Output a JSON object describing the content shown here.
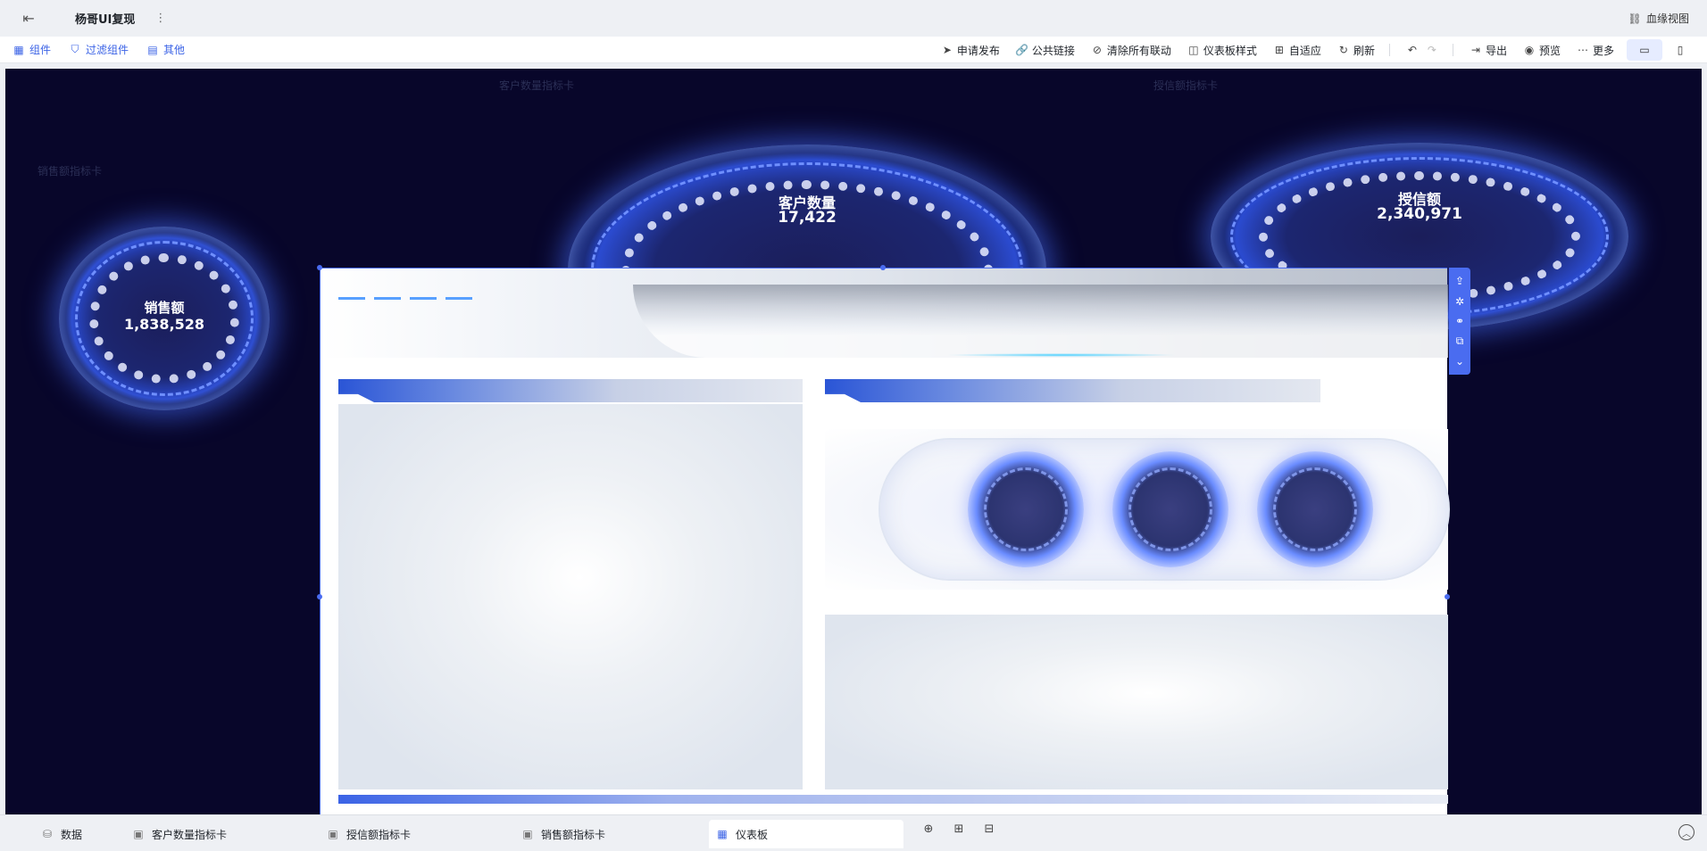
{
  "topbar": {
    "back_icon": "exit-icon",
    "title": "杨哥UI复现",
    "more_icon": "⋮",
    "lineage_label": "血缘视图"
  },
  "toolbar": {
    "left": [
      {
        "label": "组件",
        "icon": "component-icon"
      },
      {
        "label": "过滤组件",
        "icon": "filter-component-icon"
      },
      {
        "label": "其他",
        "icon": "other-icon"
      }
    ],
    "right": [
      {
        "label": "申请发布",
        "icon": "send-icon"
      },
      {
        "label": "公共链接",
        "icon": "link-icon"
      },
      {
        "label": "清除所有联动",
        "icon": "unlink-icon"
      },
      {
        "label": "仪表板样式",
        "icon": "style-icon"
      },
      {
        "label": "自适应",
        "icon": "fit-icon"
      },
      {
        "label": "刷新",
        "icon": "refresh-icon"
      },
      {
        "label": "导出",
        "icon": "export-icon"
      },
      {
        "label": "预览",
        "icon": "preview-icon"
      },
      {
        "label": "更多",
        "icon": "more-icon"
      }
    ]
  },
  "canvas": {
    "card_labels": {
      "customer": "客户数量指标卡",
      "credit": "授信额指标卡",
      "sales": "销售额指标卡"
    },
    "gauges": {
      "sales": {
        "title": "销售额",
        "value": "1,838,528"
      },
      "customer": {
        "title": "客户数量",
        "value": "17,422"
      },
      "credit": {
        "title": "授信额",
        "value": "2,340,971"
      }
    }
  },
  "tabs": [
    {
      "label": "数据",
      "icon": "database-icon"
    },
    {
      "label": "客户数量指标卡",
      "icon": "chart-card-icon"
    },
    {
      "label": "授信额指标卡",
      "icon": "chart-card-icon"
    },
    {
      "label": "销售额指标卡",
      "icon": "chart-card-icon"
    },
    {
      "label": "仪表板",
      "icon": "dashboard-icon"
    }
  ],
  "colors": {
    "accent": "#3b63e6",
    "canvas_bg": "#08062a"
  }
}
